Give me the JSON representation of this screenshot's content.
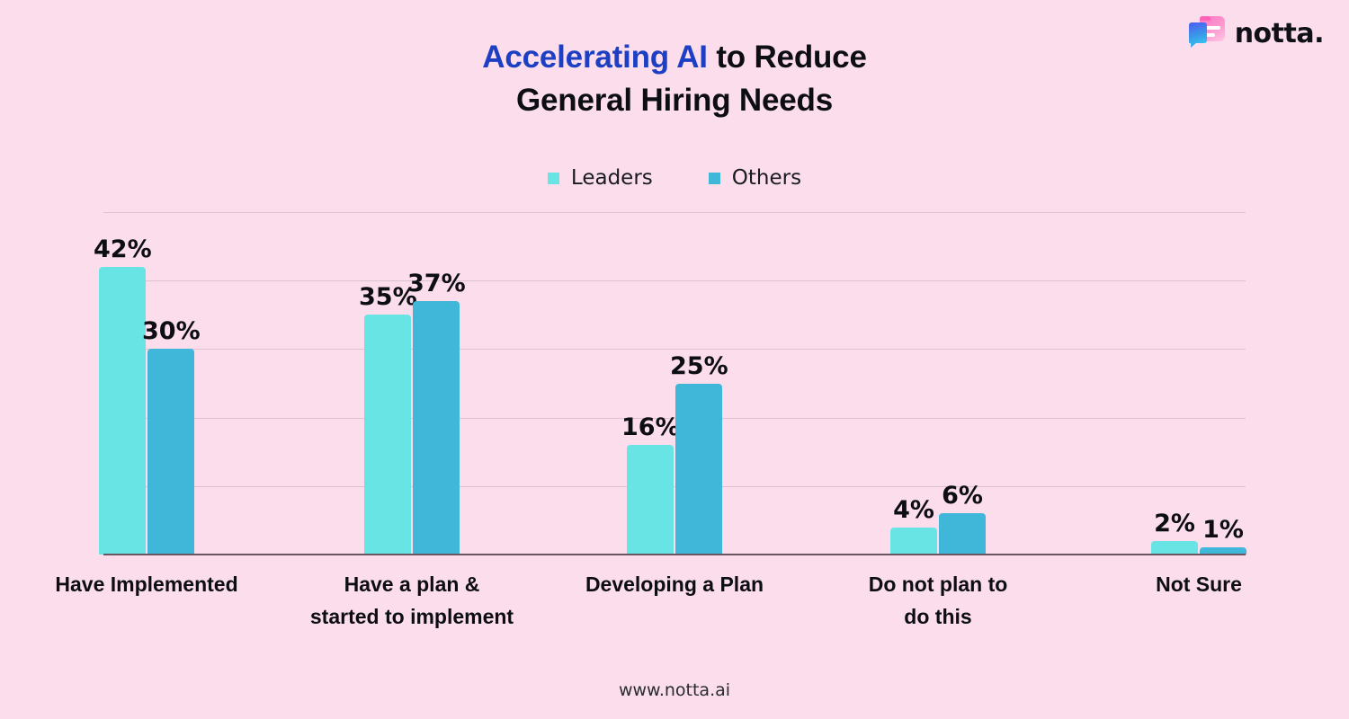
{
  "logo": {
    "wordmark": "notta.",
    "mark_icon": "notta-speech-bubble-logo-icon"
  },
  "title": {
    "accent_text": "Accelerating AI",
    "rest_line1": " to Reduce",
    "line2": "General Hiring Needs",
    "accent_color": "#1c3fc4",
    "text_color": "#0d0d14"
  },
  "footer": {
    "url": "www.notta.ai"
  },
  "chart_data": {
    "type": "bar",
    "title": "Accelerating AI to Reduce General Hiring Needs",
    "subtitle": "",
    "xlabel": "",
    "ylabel": "",
    "ylim": [
      0,
      50
    ],
    "y_unit": "%",
    "grid": true,
    "gridlines": [
      10,
      20,
      30,
      40,
      50
    ],
    "legend_position": "top-center",
    "categories": [
      "Have Implemented",
      "Have a plan &\nstarted to implement",
      "Developing a Plan",
      "Do not plan to\ndo this",
      "Not Sure"
    ],
    "series": [
      {
        "name": "Leaders",
        "color": "#68e4e4",
        "values": [
          42,
          35,
          16,
          4,
          2
        ],
        "labels": [
          "42%",
          "35%",
          "16%",
          "4%",
          "2%"
        ]
      },
      {
        "name": "Others",
        "color": "#40b6d8",
        "values": [
          30,
          37,
          25,
          6,
          1
        ],
        "labels": [
          "30%",
          "37%",
          "25%",
          "6%",
          "1%"
        ]
      }
    ]
  }
}
